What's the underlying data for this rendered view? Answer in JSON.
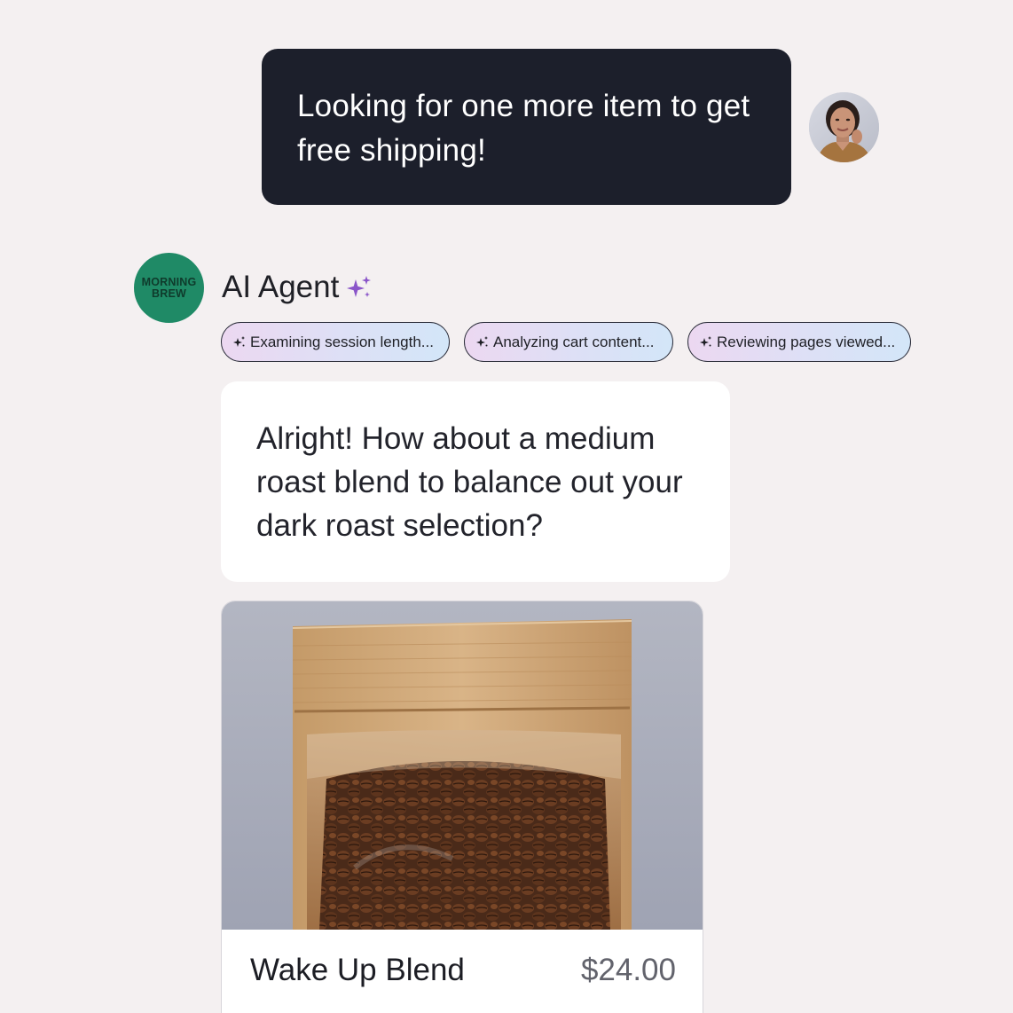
{
  "user_message": {
    "text": "Looking for one more item to get free shipping!"
  },
  "agent": {
    "brand_avatar_line1": "MORNING",
    "brand_avatar_line2": "BREW",
    "name": "AI Agent",
    "accent_color": "#8a55c9"
  },
  "status_chips": [
    {
      "label": "Examining session length..."
    },
    {
      "label": "Analyzing cart content..."
    },
    {
      "label": "Reviewing pages viewed..."
    }
  ],
  "agent_message": {
    "text": "Alright! How about a medium roast blend to balance out your dark roast selection?"
  },
  "product": {
    "name": "Wake Up Blend",
    "price": "$24.00"
  },
  "colors": {
    "background": "#f4f0f1",
    "user_bubble": "#1c1f2b",
    "brand_green": "#1f8a66"
  }
}
